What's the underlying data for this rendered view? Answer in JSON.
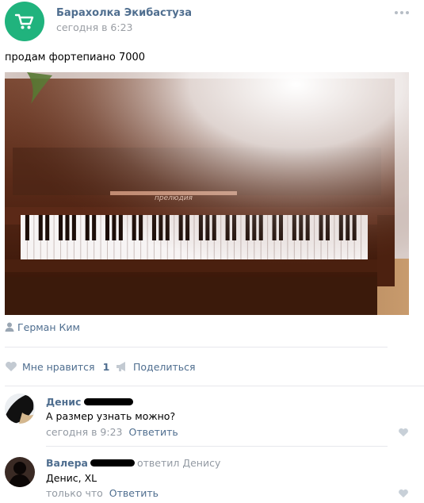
{
  "post": {
    "group_name": "Барахолка Экибастуза",
    "time": "сегодня в 6:23",
    "text": "продам фортепиано 7000",
    "photo_brand_text": "прелюдия",
    "author": "Герман Ким",
    "accent_color": "#20b37d",
    "link_color": "#4f6e8f",
    "icons": {
      "group_avatar": "shopping-cart-icon",
      "more": "more-dots-icon",
      "author": "user-icon",
      "like": "heart-icon",
      "share": "megaphone-icon"
    }
  },
  "actions": {
    "like_label": "Мне нравится",
    "like_count": "1",
    "share_label": "Поделиться"
  },
  "comments": [
    {
      "name": "Денис",
      "text": "А размер узнать можно?",
      "time": "сегодня в 9:23",
      "reply_label": "Ответить"
    },
    {
      "name": "Валера",
      "reply_to": "ответил Денису",
      "text": "Денис, XL",
      "time": "только что",
      "reply_label": "Ответить"
    }
  ]
}
